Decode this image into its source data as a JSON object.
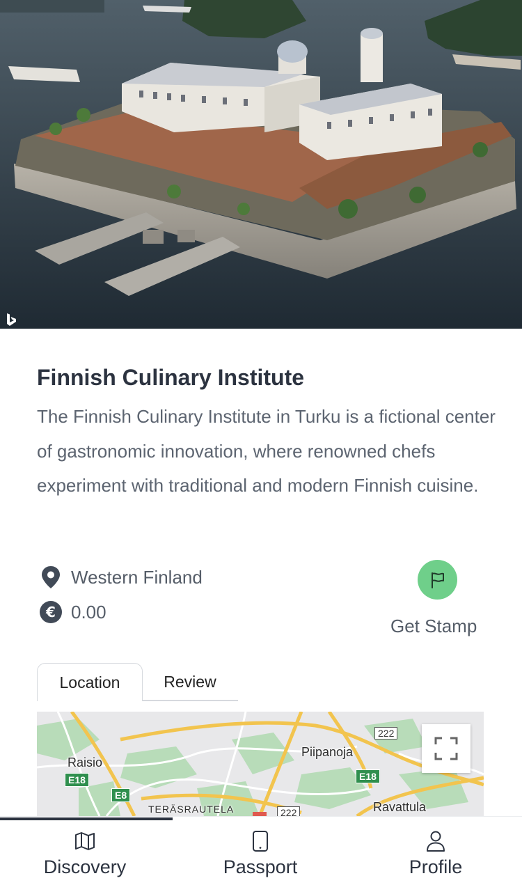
{
  "place": {
    "title": "Finnish Culinary Institute",
    "description": "The Finnish Culinary Institute in Turku is a fictional center of gastronomic innovation, where renowned chefs experiment with traditional and modern Finnish cuisine.",
    "region": "Western Finland",
    "price": "0.00",
    "region_icon": "map-pin-icon",
    "price_icon": "euro-icon"
  },
  "stamp": {
    "label": "Get Stamp",
    "icon": "flag-icon",
    "color": "#6fcf8a"
  },
  "tabs": [
    {
      "label": "Location",
      "active": true
    },
    {
      "label": "Review",
      "active": false
    }
  ],
  "map": {
    "places": [
      "Raisio",
      "Piipanoja",
      "TERÄSRAUTELA",
      "Ravattula"
    ],
    "roads": [
      "E18",
      "E8",
      "E18",
      "222",
      "222"
    ]
  },
  "nav": [
    {
      "label": "Discovery",
      "icon": "map-icon",
      "active": true
    },
    {
      "label": "Passport",
      "icon": "phone-icon",
      "active": false
    },
    {
      "label": "Profile",
      "icon": "user-icon",
      "active": false
    }
  ]
}
